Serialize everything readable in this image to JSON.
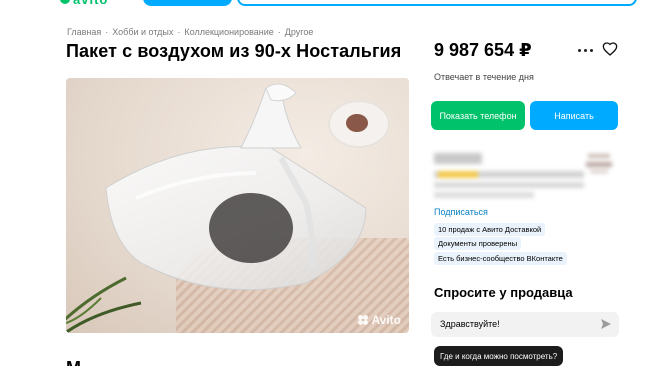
{
  "header": {
    "logo_text": "avito"
  },
  "breadcrumb": [
    "Главная",
    "Хобби и отдых",
    "Коллекционирование",
    "Другое"
  ],
  "listing": {
    "title": "Пакет с воздухом из 90-х Ностальгия",
    "price": "9 987 654 ₽",
    "response_time": "Отвечает в течение дня",
    "photo_watermark": "Avito",
    "description_heading_fragment": "М"
  },
  "actions": {
    "show_phone": "Показать телефон",
    "write": "Написать"
  },
  "seller": {
    "subscribe": "Подписаться",
    "badges": [
      "10 продаж с Авито Доставкой",
      "Документы проверены",
      "Есть бизнес-сообщество ВКонтакте"
    ]
  },
  "ask": {
    "title": "Спросите у продавца",
    "input_value": "Здравствуйте!",
    "quick_question": "Где и когда можно посмотреть?"
  },
  "icons": {
    "more": "more-dots-icon",
    "favorite": "heart-icon",
    "send": "send-icon"
  },
  "colors": {
    "green": "#00c26a",
    "blue": "#00aaff",
    "link": "#0a7fc2",
    "badge_bg": "#eaf3fb",
    "dark": "#1c1c1c"
  }
}
